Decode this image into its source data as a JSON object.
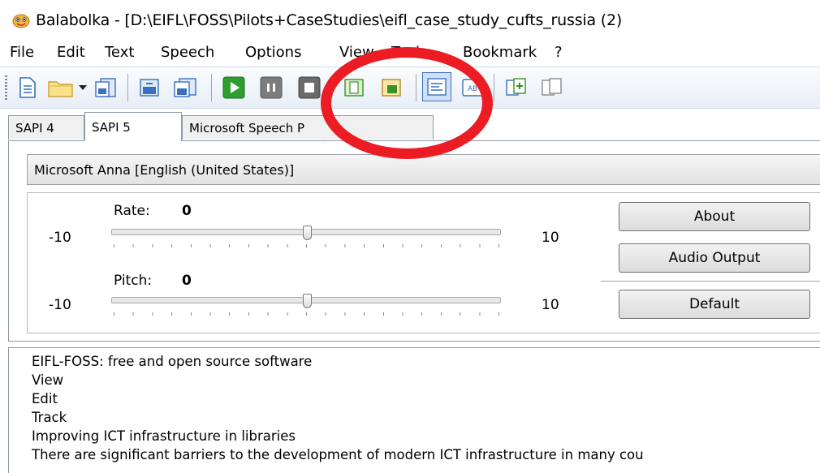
{
  "window": {
    "title": "Balabolka - [D:\\EIFL\\FOSS\\Pilots+CaseStudies\\eifl_case_study_cufts_russia (2)",
    "logo_icon": "balabolka-face-icon"
  },
  "menu": {
    "items": [
      "File",
      "Edit",
      "Text",
      "Speech",
      "Options",
      "View",
      "Tools",
      "Bookmark",
      "?"
    ]
  },
  "toolbar": {
    "buttons": [
      "new-document-icon",
      "open-folder-icon",
      "dropdown-arrow-icon",
      "save-icon",
      "save-audio-icon",
      "save-audio-as-icon",
      "play-icon",
      "pause-icon",
      "stop-icon",
      "previous-icon",
      "next-icon",
      "settings-icon",
      "spell-check-icon",
      "split-icon",
      "join-icon"
    ],
    "colors": {
      "play": "#2e9e2e",
      "pause": "#7c7c7c",
      "stop": "#6a6a6a",
      "accent": "#3a6fc0"
    }
  },
  "tabs": {
    "items": [
      "SAPI 4",
      "SAPI 5",
      "Microsoft Speech P"
    ],
    "active": "SAPI 5"
  },
  "voice": {
    "selected": "Microsoft Anna [English (United States)]"
  },
  "rate": {
    "label": "Rate:",
    "value": "0",
    "min": "-10",
    "max": "10",
    "level": 0.5
  },
  "pitch": {
    "label": "Pitch:",
    "value": "0",
    "min": "-10",
    "max": "10",
    "level": 0.5
  },
  "buttons": {
    "about": "About",
    "audio_output": "Audio Output",
    "default": "Default"
  },
  "text": {
    "lines": [
      "EIFL-FOSS: free and open source software",
      "View",
      "Edit",
      "Track",
      "Improving ICT infrastructure in libraries",
      "There are significant barriers to the development of modern ICT infrastructure in many cou"
    ]
  },
  "annotation": {
    "color": "#ec1c24"
  }
}
